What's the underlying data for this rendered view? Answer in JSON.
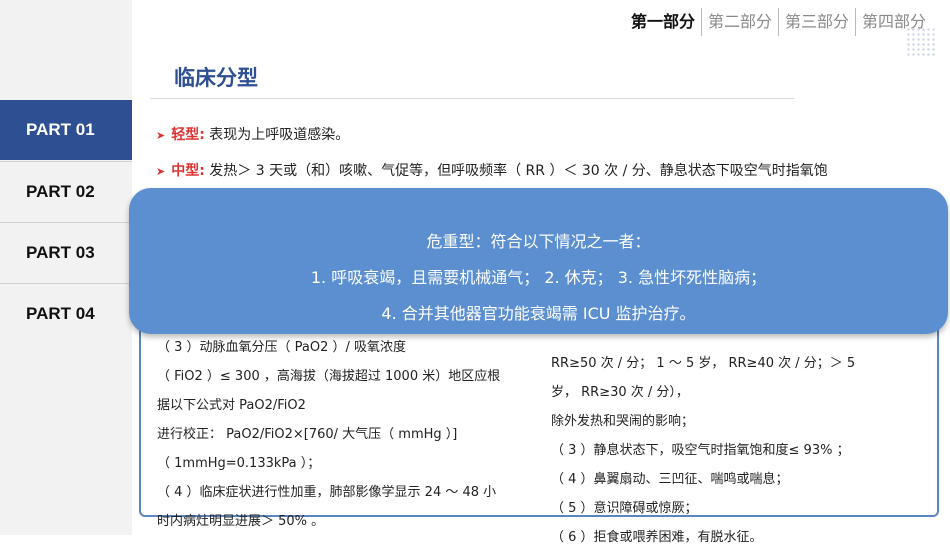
{
  "sidebar": {
    "items": [
      {
        "label": "PART 01",
        "active": true
      },
      {
        "label": "PART 02",
        "active": false
      },
      {
        "label": "PART 03",
        "active": false
      },
      {
        "label": "PART 04",
        "active": false
      }
    ]
  },
  "nav": {
    "tabs": [
      "第一部分",
      "第二部分",
      "第三部分",
      "第四部分"
    ]
  },
  "page": {
    "title": "临床分型"
  },
  "bullets": [
    {
      "label": "轻型:",
      "text": "表现为上呼吸道感染。"
    },
    {
      "label": "中型:",
      "text": "发热＞ 3 天或（和）咳嗽、气促等，但呼吸频率（ RR ）＜ 30 次 / 分、静息状态下吸空气时指氧饱"
    }
  ],
  "left_col": [
    "（ 3 ）动脉血氧分压（ PaO2 ）/ 吸氧浓度",
    "（ FiO2 ）≤ 300 ，高海拔（海拔超过  1000  米）地区应根",
    "据以下公式对  PaO2/FiO2",
    "进行校正： PaO2/FiO2×[760/ 大气压（ mmHg ）]",
    "（ 1mmHg=0.133kPa ）；",
    "（ 4 ）临床症状进行性加重，肺部影像学显示  24 ～ 48  小",
    "时内病灶明显进展＞ 50% 。"
  ],
  "right_col": [
    "RR≥50  次 / 分； 1 ～ 5  岁， RR≥40  次 / 分；＞ 5",
    "岁， RR≥30  次 / 分），",
    "除外发热和哭闹的影响；",
    "（ 3 ）静息状态下，吸空气时指氧饱和度≤ 93% ；",
    "（ 4 ）鼻翼扇动、三凹征、喘鸣或喘息；",
    "（ 5 ）意识障碍或惊厥；",
    "（ 6 ）拒食或喂养困难，有脱水征。"
  ],
  "overlay": {
    "lines": [
      "危重型：符合以下情况之一者：",
      "1. 呼吸衰竭，且需要机械通气； 2. 休克； 3. 急性坏死性脑病；",
      "4. 合并其他器官功能衰竭需  ICU  监护治疗。"
    ]
  },
  "colors": {
    "sidebar_active": "#2e4f92",
    "title": "#2e4f92",
    "bullet_label": "#dd3333",
    "overlay_bg": "#5b8fcf",
    "panel_border": "#5b86bd"
  }
}
